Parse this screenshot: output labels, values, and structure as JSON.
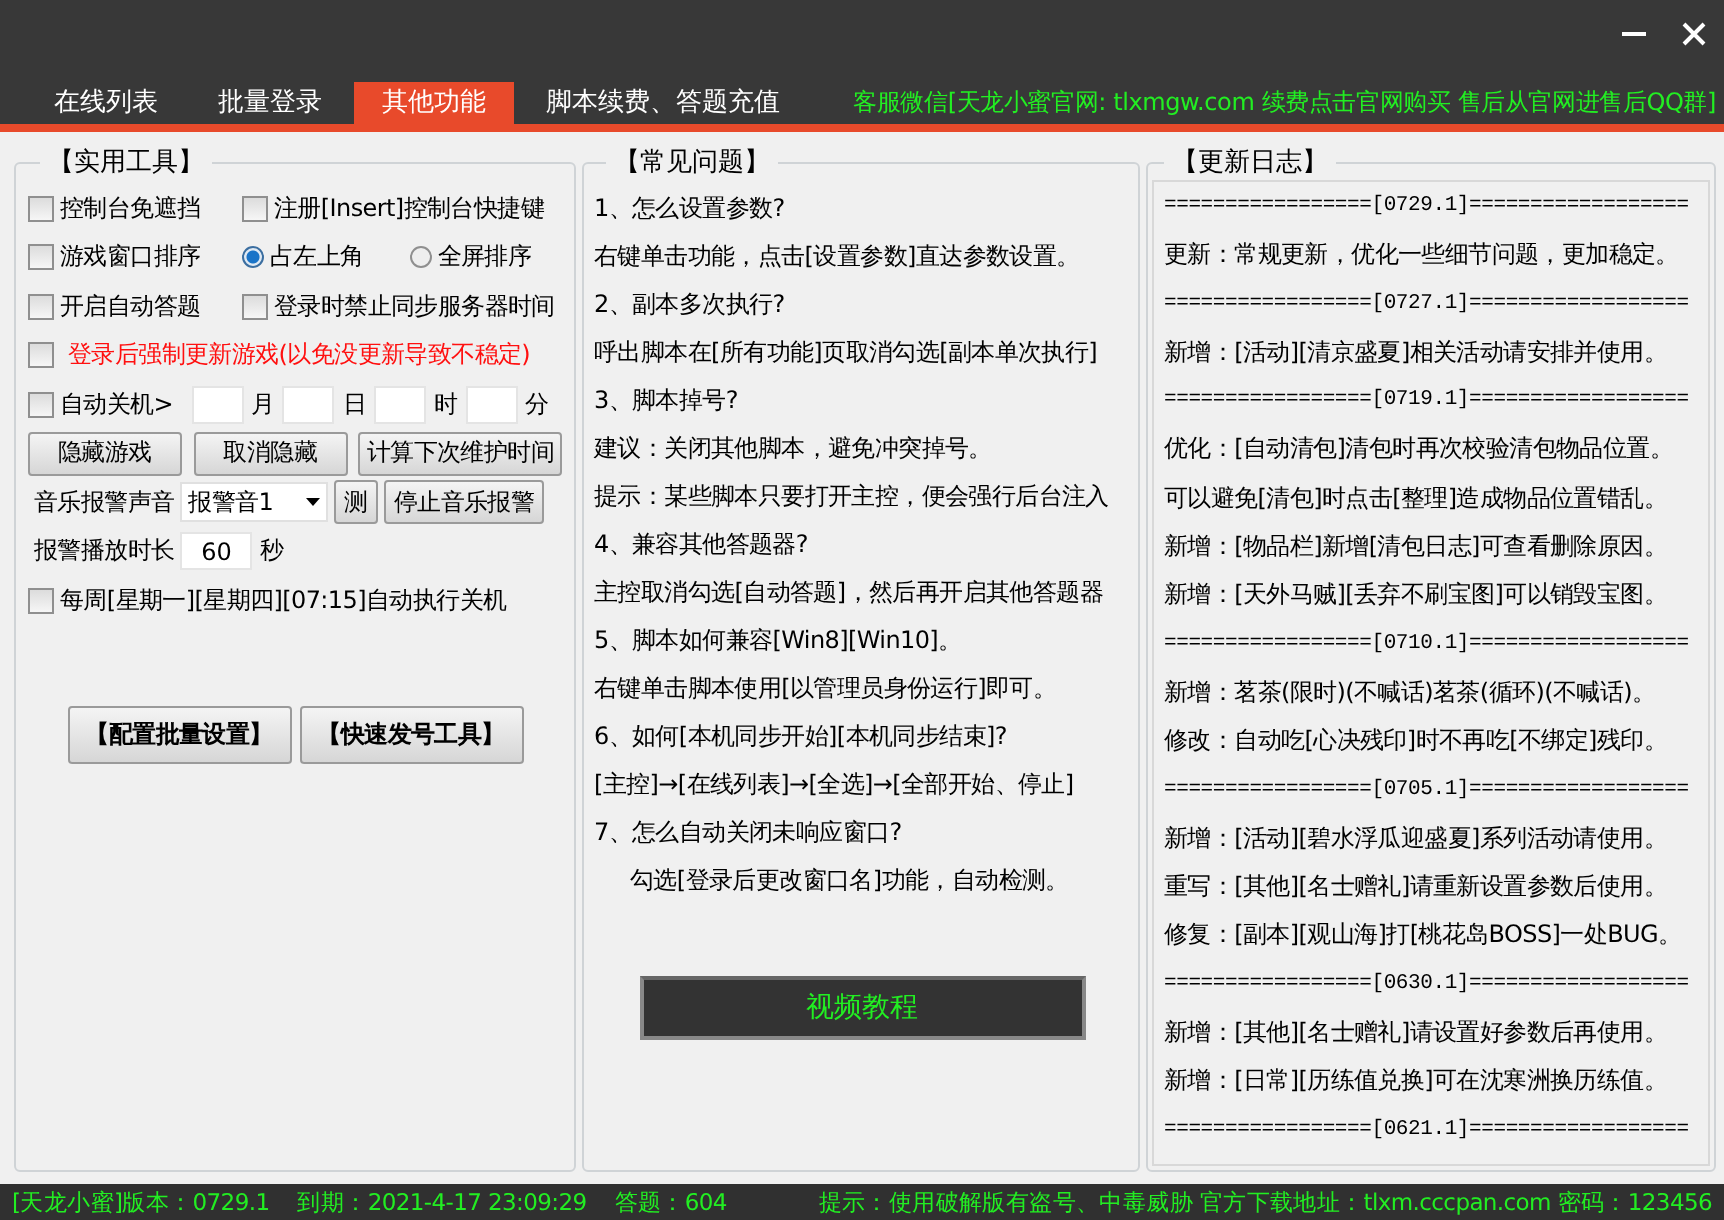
{
  "tabs": [
    {
      "label": "在线列表",
      "selected": false
    },
    {
      "label": "批量登录",
      "selected": false
    },
    {
      "label": "其他功能",
      "selected": true
    },
    {
      "label": "脚本续费、答题充值",
      "selected": false
    }
  ],
  "notice": "客服微信[天龙小蜜官网: tlxmgw.com 续费点击官网购买 售后从官网进售后QQ群]",
  "tools": {
    "title": "【实用工具】",
    "rows": [
      {
        "items": [
          {
            "kind": "checkbox",
            "label": "控制台免遮挡",
            "checked": false,
            "warning": false
          },
          {
            "kind": "checkbox",
            "label": "注册[Insert]控制台快捷键",
            "checked": false,
            "warning": false
          }
        ]
      },
      {
        "items": [
          {
            "kind": "checkbox",
            "label": "游戏窗口排序",
            "checked": false,
            "warning": false
          },
          {
            "kind": "radio",
            "label": "占左上角",
            "selected": true
          },
          {
            "kind": "radio",
            "label": "全屏排序",
            "selected": false
          }
        ]
      },
      {
        "items": [
          {
            "kind": "checkbox",
            "label": "开启自动答题",
            "checked": false,
            "warning": false
          },
          {
            "kind": "checkbox",
            "label": "登录时禁止同步服务器时间",
            "checked": false,
            "warning": false
          }
        ]
      },
      {
        "items": [
          {
            "kind": "checkbox",
            "label": "登录后强制更新游戏(以免没更新导致不稳定)",
            "checked": false,
            "warning": true
          }
        ]
      },
      {
        "items": [
          {
            "kind": "checkbox",
            "label": "自动关机>",
            "checked": false,
            "warning": false
          },
          {
            "kind": "field",
            "value": ""
          },
          {
            "kind": "unit",
            "text": "月"
          },
          {
            "kind": "field",
            "value": ""
          },
          {
            "kind": "unit",
            "text": "日"
          },
          {
            "kind": "field",
            "value": ""
          },
          {
            "kind": "unit",
            "text": "时"
          },
          {
            "kind": "field",
            "value": ""
          },
          {
            "kind": "unit",
            "text": "分"
          }
        ]
      },
      {
        "items": [
          {
            "kind": "button",
            "label": "隐藏游戏"
          },
          {
            "kind": "button",
            "label": "取消隐藏"
          },
          {
            "kind": "button",
            "label": "计算下次维护时间"
          }
        ]
      },
      {
        "items": [
          {
            "kind": "label",
            "text": "音乐报警声音"
          },
          {
            "kind": "dropdown",
            "value": "报警音1"
          },
          {
            "kind": "button",
            "label": "测"
          },
          {
            "kind": "button",
            "label": "停止音乐报警"
          }
        ]
      },
      {
        "items": [
          {
            "kind": "label",
            "text": "报警播放时长"
          },
          {
            "kind": "field",
            "value": "60"
          },
          {
            "kind": "unit",
            "text": "秒"
          }
        ]
      },
      {
        "items": [
          {
            "kind": "checkbox",
            "label": "每周[星期一][星期四][07:15]自动执行关机",
            "checked": false,
            "warning": false
          }
        ]
      }
    ],
    "buttons": [
      "【配置批量设置】",
      "【快速发号工具】"
    ]
  },
  "faq": {
    "title": "【常见问题】",
    "lines": [
      {
        "text": "1、怎么设置参数?",
        "indented": false
      },
      {
        "text": "右键单击功能，点击[设置参数]直达参数设置。",
        "indented": false
      },
      {
        "text": "2、副本多次执行?",
        "indented": false
      },
      {
        "text": "呼出脚本在[所有功能]页取消勾选[副本单次执行]",
        "indented": false
      },
      {
        "text": "3、脚本掉号?",
        "indented": false
      },
      {
        "text": "建议：关闭其他脚本，避免冲突掉号。",
        "indented": false
      },
      {
        "text": "提示：某些脚本只要打开主控，便会强行后台注入",
        "indented": false
      },
      {
        "text": "4、兼容其他答题器?",
        "indented": false
      },
      {
        "text": "主控取消勾选[自动答题]，然后再开启其他答题器",
        "indented": false
      },
      {
        "text": "5、脚本如何兼容[Win8][Win10]。",
        "indented": false
      },
      {
        "text": "右键单击脚本使用[以管理员身份运行]即可。",
        "indented": false
      },
      {
        "text": "6、如何[本机同步开始][本机同步结束]?",
        "indented": false
      },
      {
        "text": "[主控]→[在线列表]→[全选]→[全部开始、停止]",
        "indented": false
      },
      {
        "text": "7、怎么自动关闭未响应窗口?",
        "indented": false
      },
      {
        "text": "勾选[登录后更改窗口名]功能，自动检测。",
        "indented": true
      }
    ],
    "video_button": "视频教程"
  },
  "log": {
    "title": "【更新日志】",
    "lines": [
      "=================[0729.1]==================",
      "更新：常规更新，优化一些细节问题，更加稳定。",
      "=================[0727.1]==================",
      "新增：[活动][清京盛夏]相关活动请安排并使用。",
      "=================[0719.1]==================",
      "优化：[自动清包]清包时再次校验清包物品位置。",
      "可以避免[清包]时点击[整理]造成物品位置错乱。",
      "新增：[物品栏]新增[清包日志]可查看删除原因。",
      "新增：[天外马贼][丢弃不刷宝图]可以销毁宝图。",
      "=================[0710.1]==================",
      "新增：茗茶(限时)(不喊话)茗茶(循环)(不喊话)。",
      "修改：自动吃[心决残印]时不再吃[不绑定]残印。",
      "=================[0705.1]==================",
      "新增：[活动][碧水浮瓜迎盛夏]系列活动请使用。",
      "重写：[其他][名士赠礼]请重新设置参数后使用。",
      "修复：[副本][观山海]打[桃花岛BOSS]一处BUG。",
      "=================[0630.1]==================",
      "新增：[其他][名士赠礼]请设置好参数后再使用。",
      "新增：[日常][历练值兑换]可在沈寒洲换历练值。",
      "=================[0621.1]=================="
    ]
  },
  "status": {
    "left": [
      "[天龙小蜜]版本：0729.1",
      "到期：2021-4-17 23:09:29",
      "答题：604"
    ],
    "right": "提示：使用破解版有盗号、中毒威胁 官方下载地址：tlxm.cccpan.com 密码：123456"
  }
}
